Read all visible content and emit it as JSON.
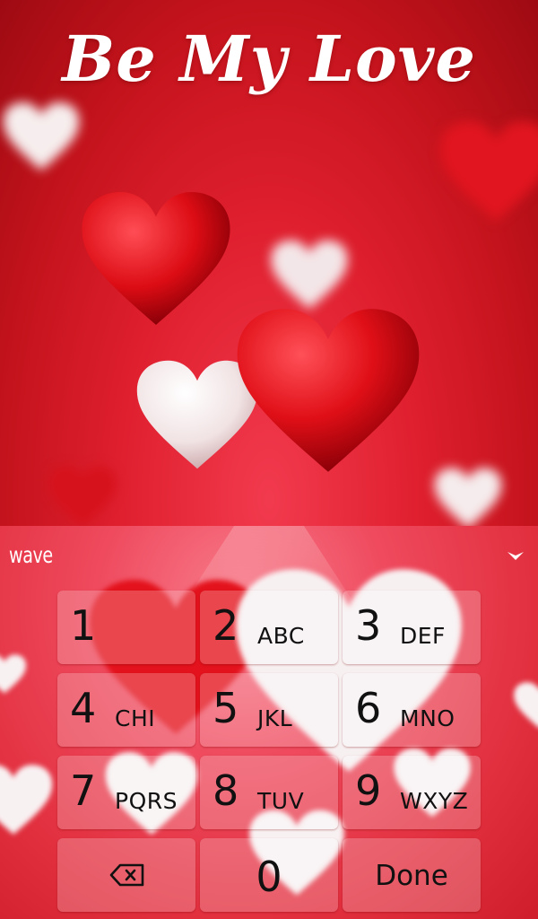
{
  "wallpaper": {
    "title": "Be My Love",
    "colors": {
      "background": "#c8151d",
      "red_heart": "#d80c15",
      "white_heart": "#f4eeee",
      "title_text": "#ffffff"
    }
  },
  "keyboard": {
    "brand": "wave",
    "collapse_icon": "chevron-down-icon",
    "keys": [
      {
        "num": "1",
        "letters": ""
      },
      {
        "num": "2",
        "letters": "ABC"
      },
      {
        "num": "3",
        "letters": "DEF"
      },
      {
        "num": "4",
        "letters": "CHI"
      },
      {
        "num": "5",
        "letters": "JKL"
      },
      {
        "num": "6",
        "letters": "MNO"
      },
      {
        "num": "7",
        "letters": "PQRS"
      },
      {
        "num": "8",
        "letters": "TUV"
      },
      {
        "num": "9",
        "letters": "WXYZ"
      }
    ],
    "backspace_icon": "backspace-icon",
    "zero": "0",
    "done": "Done",
    "colors": {
      "key_text": "#111111",
      "background": "#e8394b"
    }
  }
}
